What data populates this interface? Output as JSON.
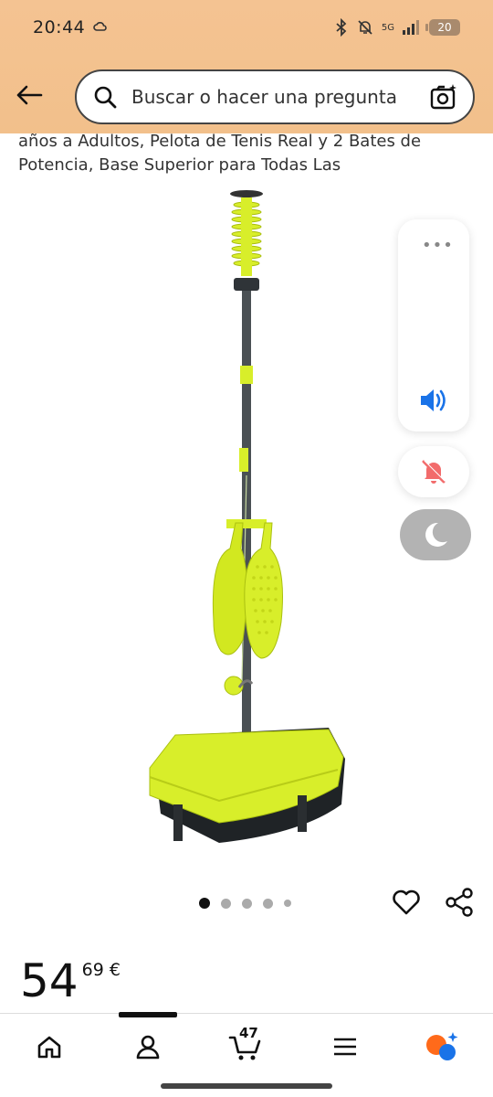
{
  "status_bar": {
    "time": "20:44",
    "battery": "20",
    "network": "5G"
  },
  "search": {
    "placeholder": "Buscar o hacer una pregunta"
  },
  "product": {
    "title_lines": [
      "años a Adultos, Pelota de Tenis Real y 2 Bates de",
      "Potencia, Base Superior para Todas Las"
    ],
    "image_icon": "tennis-trainer-product-image"
  },
  "side_panel": {
    "menu_label": "•••"
  },
  "carousel": {
    "count": 5,
    "active_index": 0
  },
  "price": {
    "whole": "54",
    "cents": "69",
    "currency": "€"
  },
  "nav": {
    "cart_count": "47",
    "items": [
      "home-icon",
      "account-icon",
      "cart-icon",
      "menu-icon",
      "rufus-icon"
    ]
  },
  "colors": {
    "header_bg": "#f3c18e",
    "accent_blue": "#1a73e8",
    "mute_red": "#f26b6b",
    "product_yellow": "#d8ee2a"
  }
}
